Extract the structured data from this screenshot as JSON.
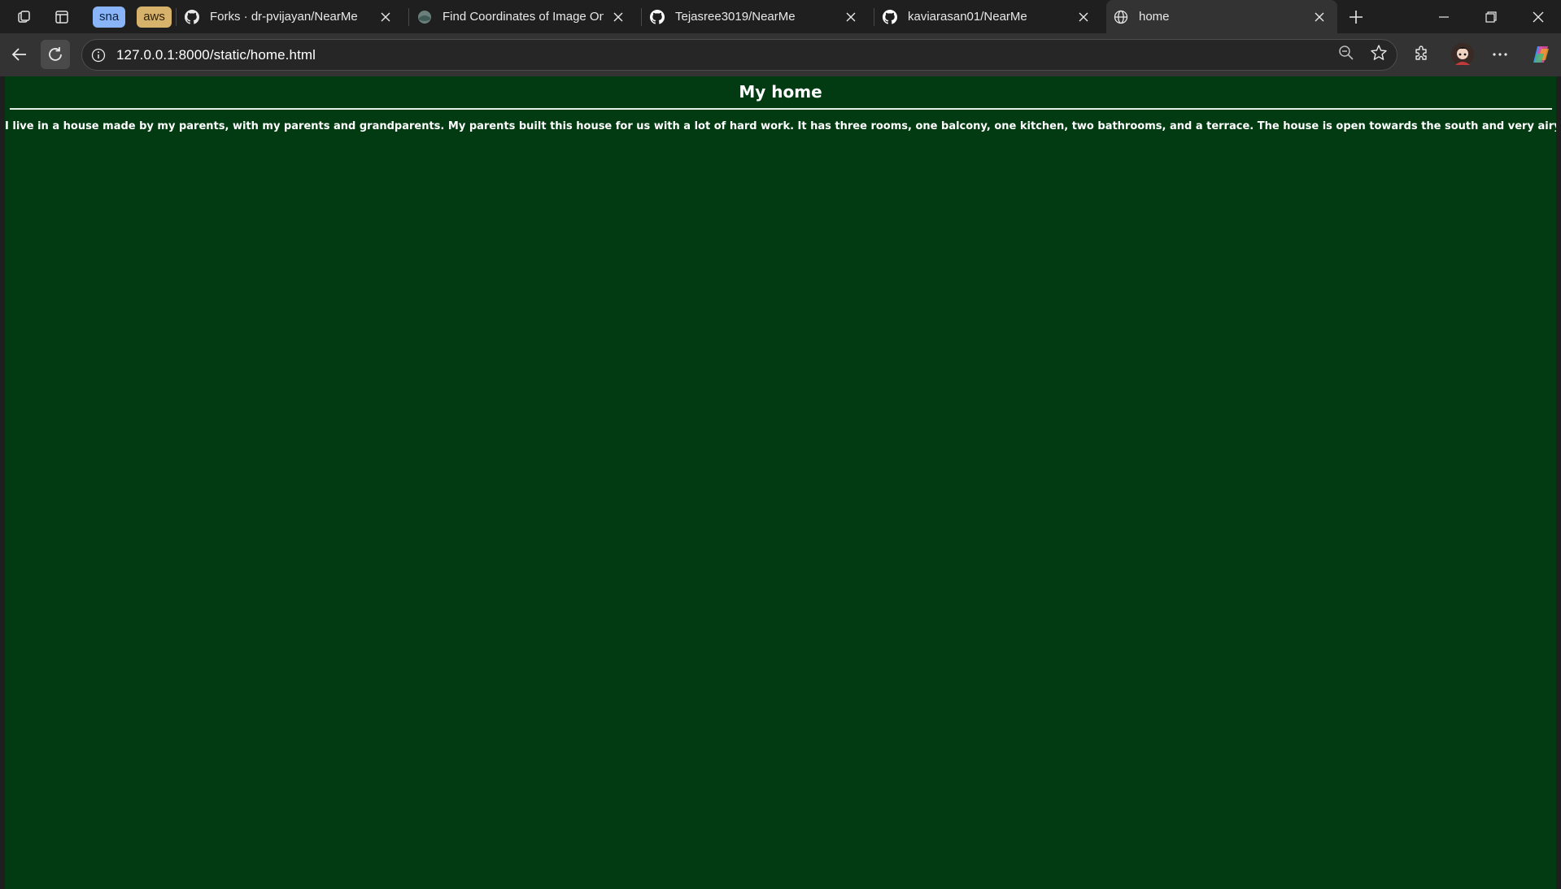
{
  "browser": {
    "tab_groups": [
      {
        "label": "sna",
        "color": "#8ab4f8"
      },
      {
        "label": "aws",
        "color": "#d7b26a"
      }
    ],
    "tabs": [
      {
        "title": "Forks · dr-pvijayan/NearMe",
        "icon": "github-icon"
      },
      {
        "title": "Find Coordinates of Image Onli",
        "icon": "site-globe-icon"
      },
      {
        "title": "Tejasree3019/NearMe",
        "icon": "github-icon"
      },
      {
        "title": "kaviarasan01/NearMe",
        "icon": "github-icon"
      },
      {
        "title": "home",
        "icon": "globe-icon",
        "active": true
      }
    ],
    "address": {
      "url": "127.0.0.1:8000/static/home.html"
    }
  },
  "page": {
    "background": "#023a11",
    "title": "My home",
    "body": "I live in a house made by my parents, with my parents and grandparents. My parents built this house for us with a lot of hard work. It has three rooms, one balcony, one kitchen, two bathrooms, and a terrace. The house is open towards the south and very airy."
  }
}
